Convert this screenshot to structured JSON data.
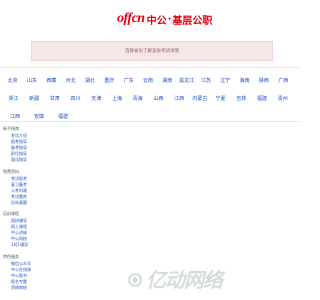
{
  "logo": {
    "en": "offcn",
    "cn": "中公",
    "dot": "·",
    "sub": "基层公职"
  },
  "banner": {
    "text": "选择省份了解该省考试详情"
  },
  "regions": [
    [
      "北京",
      "山东",
      "西藏",
      "河北",
      "湖北",
      "重庆",
      "广东",
      "云南",
      "湖南",
      "黑龙江",
      "江苏",
      "辽宁",
      "海南",
      "陕西",
      "广西"
    ],
    [
      "浙江",
      "新疆",
      "甘肃",
      "四川",
      "天津",
      "上海",
      "青海",
      "山西",
      "江西",
      "内蒙古",
      "宁夏",
      "吉林",
      "福建",
      "贵州"
    ],
    [
      "江西",
      "安徽",
      "福建"
    ]
  ],
  "categories": [
    {
      "title": "新手指南",
      "links": [
        "考试介绍",
        "报考指导",
        "备考指导",
        "职位指导",
        "面试指导"
      ]
    },
    {
      "title": "免费资料",
      "links": [
        "考试报考",
        "复习备考",
        "公考时政",
        "考试题库",
        "历年真题"
      ]
    },
    {
      "title": "培训课程",
      "links": [
        "面授辅导",
        "网上课程",
        "中公讲座",
        "中公网校",
        "1对1辅导"
      ]
    },
    {
      "title": "特色服务",
      "links": [
        "微信公众号",
        "中公在线课",
        "中公图书",
        "报名专题",
        "资格审核"
      ]
    }
  ],
  "watermark": {
    "text": "亿动网络",
    "domain_suffix": ""
  },
  "colors": {
    "brand": "#e60012",
    "link": "#1a4fc7",
    "banner_bg": "#f6e6e6"
  }
}
